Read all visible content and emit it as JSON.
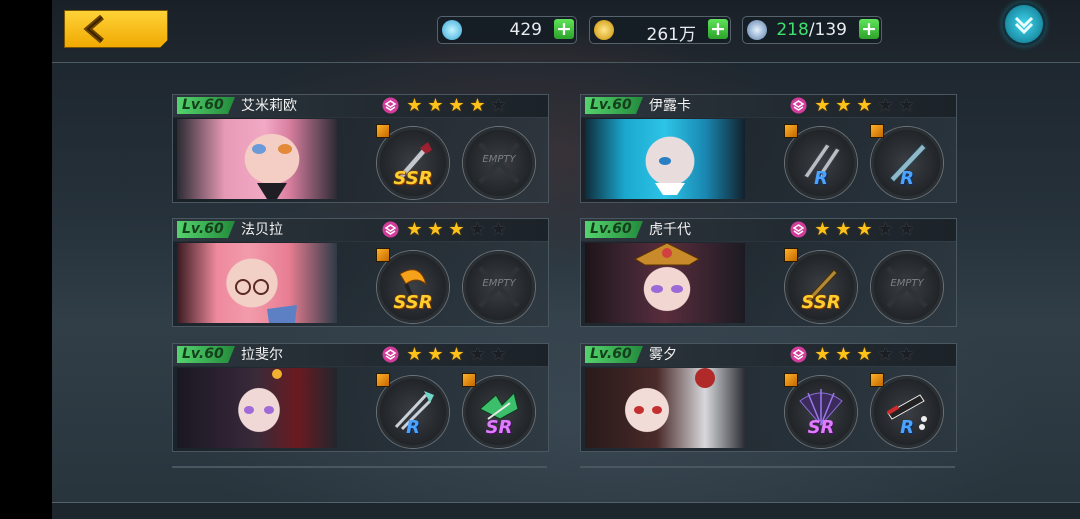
{
  "top_bar": {
    "back_label": "",
    "diamond": "429",
    "gold": "261万",
    "stamina_current": "218",
    "stamina_max": "/139"
  },
  "colors": {
    "accent_yellow": "#f5b800",
    "plus_green": "#3bc43a",
    "level_green": "#3fb456",
    "ssr_gold": "#ffcf2e",
    "sr_purple": "#e07cff",
    "r_blue": "#4aa3ff"
  },
  "heroes": [
    {
      "level": "Lv.60",
      "name": "艾米莉欧",
      "stars": 4,
      "weapon1": "SSR",
      "weapon2": "EMPTY"
    },
    {
      "level": "Lv.60",
      "name": "伊露卡",
      "stars": 3,
      "weapon1": "R",
      "weapon2": "R"
    },
    {
      "level": "Lv.60",
      "name": "法贝拉",
      "stars": 3,
      "weapon1": "SSR",
      "weapon2": "EMPTY"
    },
    {
      "level": "Lv.60",
      "name": "虎千代",
      "stars": 3,
      "weapon1": "SSR",
      "weapon2": "EMPTY"
    },
    {
      "level": "Lv.60",
      "name": "拉斐尔",
      "stars": 3,
      "weapon1": "R",
      "weapon2": "SR"
    },
    {
      "level": "Lv.60",
      "name": "雾夕",
      "stars": 3,
      "weapon1": "SR",
      "weapon2": "R"
    }
  ]
}
